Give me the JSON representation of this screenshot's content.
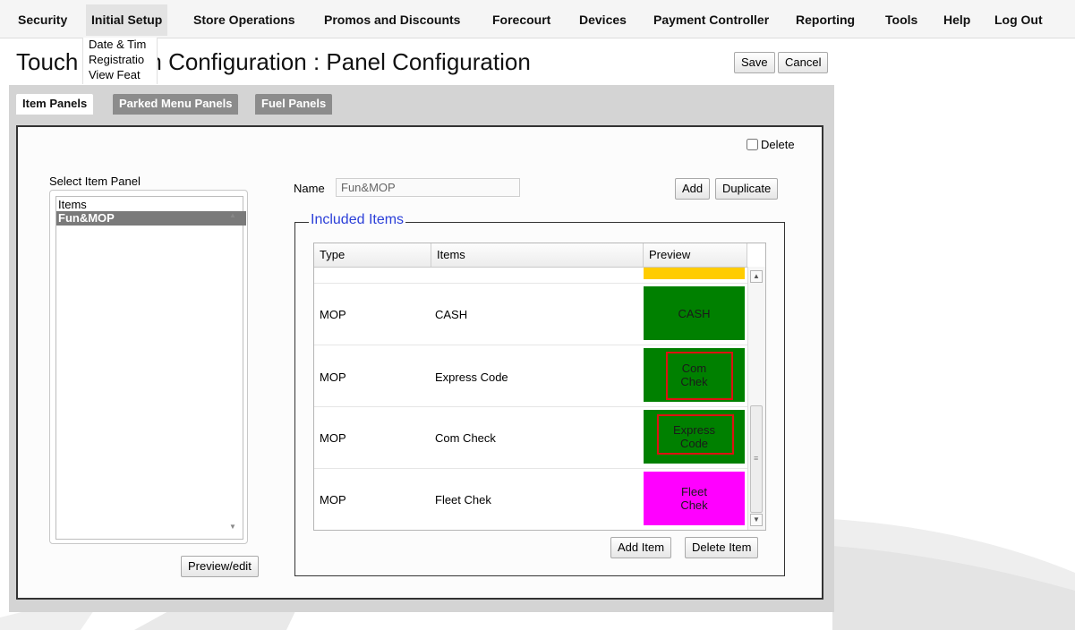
{
  "nav": {
    "items": [
      "Security",
      "Initial Setup",
      "Store Operations",
      "Promos and Discounts",
      "Forecourt",
      "Devices",
      "Payment Controller",
      "Reporting",
      "Tools",
      "Help",
      "Log Out"
    ]
  },
  "dropdown": {
    "items": [
      "Date & Tim",
      "Registratio",
      "View Feat"
    ]
  },
  "page": {
    "title": "Touch Screen Configuration : Panel Configuration",
    "title_visible_part1": "Touch",
    "title_visible_part2": "n Configuration : Panel Configuration",
    "save": "Save",
    "cancel": "Cancel"
  },
  "tabs": [
    "Item Panels",
    "Parked Menu Panels",
    "Fuel Panels"
  ],
  "panel": {
    "delete_label": "Delete",
    "delete_checked": false,
    "select_label": "Select Item Panel",
    "list_items": [
      "Items",
      "Fun&MOP"
    ],
    "selected_index": 1,
    "preview_edit": "Preview/edit",
    "name_label": "Name",
    "name_value": "Fun&MOP",
    "add": "Add",
    "duplicate": "Duplicate",
    "included_label": "Included Items",
    "add_item": "Add Item",
    "delete_item": "Delete Item"
  },
  "grid": {
    "headers": [
      "Type",
      "Items",
      "Preview"
    ],
    "rows": [
      {
        "type": "MOP",
        "item": "CASH",
        "preview": "CASH",
        "color": "#008000",
        "highlight": false
      },
      {
        "type": "MOP",
        "item": "Express Code",
        "preview": "Com\nChek",
        "color": "#008000",
        "highlight": true
      },
      {
        "type": "MOP",
        "item": "Com Check",
        "preview": "Express\nCode",
        "color": "#008000",
        "highlight": true
      },
      {
        "type": "MOP",
        "item": "Fleet Chek",
        "preview": "Fleet\nChek",
        "color": "#ff00ff",
        "highlight": false
      }
    ],
    "partial_top_preview_color": "#ffcc00"
  },
  "colors": {
    "legend": "#2b3fd8",
    "highlight_border": "#dd1111",
    "selected_list": "#7a7a7a"
  }
}
